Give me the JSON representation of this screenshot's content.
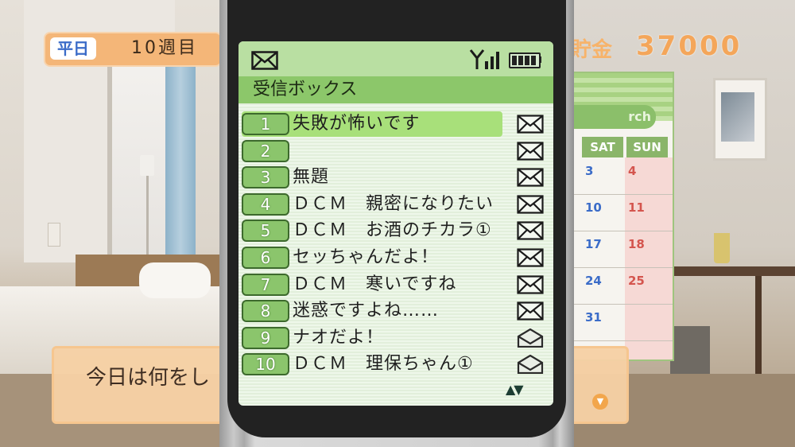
{
  "hud": {
    "day_type": "平日",
    "week": "10週目",
    "money_label": "貯金",
    "money_value": "37000"
  },
  "calendar": {
    "month_partial": "rch",
    "headers": [
      "SAT",
      "SUN"
    ],
    "sat_days": [
      "3",
      "10",
      "17",
      "24",
      "31"
    ],
    "sun_days": [
      "4",
      "11",
      "18",
      "25"
    ]
  },
  "dialogue": {
    "text": "今日は何をし",
    "next_indicator": "▼"
  },
  "phone": {
    "inbox_title": "受信ボックス",
    "icons": [
      "envelope-icon",
      "signal-icon",
      "battery-icon"
    ],
    "scroll": "▲▼",
    "messages": [
      {
        "num": "1",
        "subject": "失敗が怖いです",
        "status": "unread"
      },
      {
        "num": "2",
        "subject": "",
        "status": "unread"
      },
      {
        "num": "3",
        "subject": "無題",
        "status": "unread"
      },
      {
        "num": "4",
        "subject": "ＤＣＭ　親密になりたい",
        "status": "unread"
      },
      {
        "num": "5",
        "subject": "ＤＣＭ　お酒のチカラ①",
        "status": "unread"
      },
      {
        "num": "6",
        "subject": "セッちゃんだよ！",
        "status": "unread"
      },
      {
        "num": "7",
        "subject": "ＤＣＭ　寒いですね",
        "status": "unread"
      },
      {
        "num": "8",
        "subject": "迷惑ですよね……",
        "status": "unread"
      },
      {
        "num": "9",
        "subject": "ナオだよ！",
        "status": "read"
      },
      {
        "num": "10",
        "subject": "ＤＣＭ　理保ちゃん①",
        "status": "read"
      }
    ],
    "selected_index": 0
  },
  "colors": {
    "selected_row": "#a8e07a",
    "number_badge": "#8bc56c",
    "status_bar": "#b9dfa2",
    "title_bar": "#8cc76a"
  }
}
